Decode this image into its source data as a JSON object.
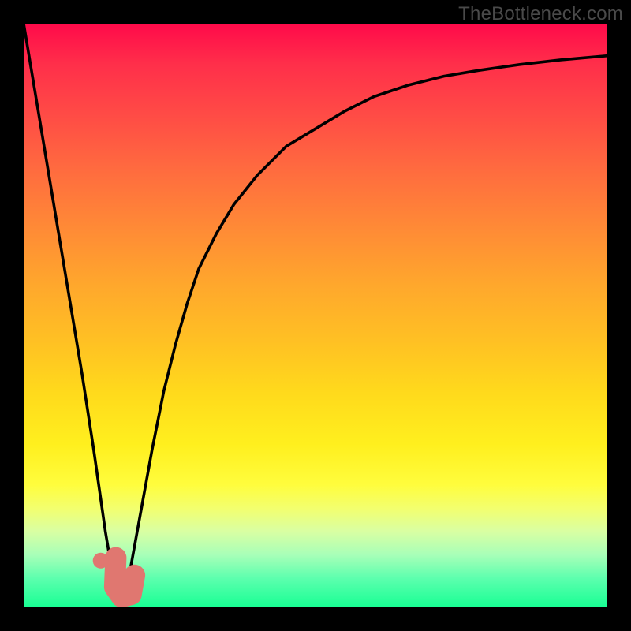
{
  "watermark": "TheBottleneck.com",
  "colors": {
    "background": "#000000",
    "marker": "#e07770",
    "curve": "#000000",
    "gradient_top": "#ff0a4a",
    "gradient_bottom": "#18ff94"
  },
  "chart_data": {
    "type": "line",
    "title": "",
    "xlabel": "",
    "ylabel": "",
    "xlim": [
      0,
      100
    ],
    "ylim": [
      0,
      100
    ],
    "grid": false,
    "legend": false,
    "series": [
      {
        "name": "bottleneck-curve",
        "x": [
          0,
          2,
          4,
          6,
          8,
          10,
          12,
          13,
          14,
          15,
          16,
          17,
          18,
          20,
          22,
          24,
          26,
          28,
          30,
          33,
          36,
          40,
          45,
          50,
          55,
          60,
          66,
          72,
          78,
          85,
          92,
          100
        ],
        "values": [
          100,
          88,
          76,
          64,
          52,
          40,
          27,
          20,
          13,
          7,
          2,
          1,
          5,
          16,
          27,
          37,
          45,
          52,
          58,
          64,
          69,
          74,
          79,
          82,
          85,
          87.5,
          89.5,
          91,
          92,
          93,
          93.8,
          94.5
        ]
      }
    ],
    "marker": {
      "name": "J-marker",
      "dot": {
        "x": 13.2,
        "y": 8
      },
      "points": [
        {
          "x": 15.8,
          "y": 8.5
        },
        {
          "x": 15.6,
          "y": 3.5
        },
        {
          "x": 16.8,
          "y": 1.8
        },
        {
          "x": 18.4,
          "y": 2.2
        },
        {
          "x": 19.0,
          "y": 5.5
        }
      ]
    }
  }
}
